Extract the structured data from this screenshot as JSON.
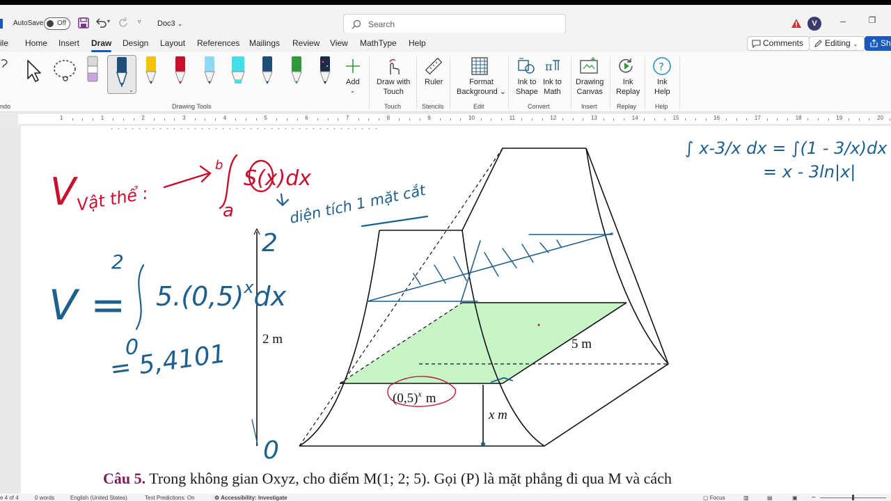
{
  "titlebar": {
    "autosave_label": "AutoSave",
    "toggle_state": "Off",
    "doc_name": "Doc3",
    "search_placeholder": "Search",
    "avatar_initial": "V"
  },
  "tabs": [
    "ile",
    "Home",
    "Insert",
    "Draw",
    "Design",
    "Layout",
    "References",
    "Mailings",
    "Review",
    "View",
    "MathType",
    "Help"
  ],
  "active_tab": "Draw",
  "right_buttons": {
    "comments": "Comments",
    "editing": "Editing",
    "share": "Sha"
  },
  "ribbon": {
    "undo_group": "ndo",
    "drawing_tools": "Drawing Tools",
    "add": "Add",
    "draw_with_touch": [
      "Draw with",
      "Touch"
    ],
    "touch_group": "Touch",
    "ruler": "Ruler",
    "stencils_group": "Stencils",
    "format_background": [
      "Format",
      "Background"
    ],
    "edit_group": "Edit",
    "ink_to_shape": [
      "Ink to",
      "Shape"
    ],
    "ink_to_math": [
      "Ink to",
      "Math"
    ],
    "convert_group": "Convert",
    "drawing_canvas": [
      "Drawing",
      "Canvas"
    ],
    "insert_group": "Insert",
    "ink_replay": [
      "Ink",
      "Replay"
    ],
    "replay_group": "Replay",
    "ink_help": [
      "Ink",
      "Help"
    ],
    "help_group": "Help",
    "pen_colors": [
      "#f6c300",
      "#c8102e",
      "#8ed8f8",
      "#40e0e8",
      "#1f4e79",
      "#2e9b3a",
      "#1f2a44"
    ]
  },
  "ruler_numbers": [
    "1",
    "1",
    "2",
    "3",
    "4",
    "5",
    "6",
    "7",
    "8",
    "9",
    "10",
    "11",
    "12",
    "13",
    "14",
    "15",
    "16",
    "17",
    "18",
    "19",
    "20"
  ],
  "figure": {
    "label_2m": "2 m",
    "label_5m": "5 m",
    "label_xm": "x m",
    "label_base": "(0,5)",
    "label_exp": "x",
    "label_unit": "m",
    "fill_color": "#c8f5c8"
  },
  "handwriting": {
    "v_vat_the": "V",
    "vat_the": "Vật thể :",
    "b_limit": "b",
    "a_limit": "a",
    "integrand": "S(x)dx",
    "dien_tich": "diện tích 1 mặt cắt",
    "v_formula": "V =",
    "upper": "2",
    "lower": "0",
    "integral_body": "5.(0,5)",
    "exp": "x",
    "dx": "dx",
    "result": "= 5,4101",
    "axis_top": "2",
    "axis_bottom": "0",
    "right_top": "∫ x-3/x dx = ∫(1 - 3/x)dx",
    "right_bottom": "= x - 3ln|x|",
    "ink_red": "#c8102e",
    "ink_blue": "#1f5f8b"
  },
  "question": {
    "number": "Câu 5.",
    "text": "Trong không gian Oxyz, cho điểm M(1; 2; 5). Gọi (P) là mặt phẳng đi qua M và cách"
  },
  "status": {
    "page": "e 4 of 4",
    "words": "0 words",
    "language": "English (United States)",
    "predictions": "Text Predictions: On",
    "accessibility": "Accessibility: Investigate",
    "focus": "Focus"
  }
}
